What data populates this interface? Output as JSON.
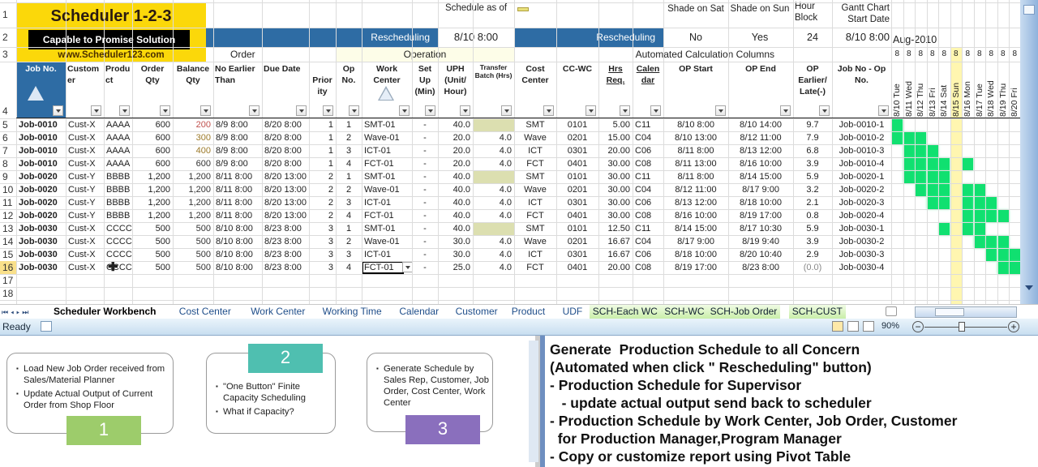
{
  "logo": {
    "title": "Scheduler 1-2-3",
    "tagline": "Capable to Promise  Solution",
    "url": "www.Scheduler123.com"
  },
  "top_controls": {
    "schedule_as_of_label": "Schedule as of",
    "schedule_as_of_value": "8/10 8:00",
    "rescheduling_left": "Rescheduling",
    "rescheduling_right": "Rescheduling",
    "shade_sat_label": "Shade on Sat",
    "shade_sat_value": "No",
    "shade_sun_label": "Shade on Sun",
    "shade_sun_value": "Yes",
    "hour_block_label": "Hour Block",
    "hour_block_value": "24",
    "gantt_start_label": "Gantt Chart Start Date",
    "gantt_start_value": "8/10 8:00",
    "gantt_month": "Aug-2010"
  },
  "section_headers": {
    "order": "Order",
    "operation": "Operation",
    "automated": "Automated Calculation Columns"
  },
  "columns": [
    "Job No.",
    "Custom er",
    "Produ ct",
    "Order Qty",
    "Balance Qty",
    "No Earlier Than",
    "Due Date",
    "Prior ity",
    "Op No.",
    "Work Center",
    "Set Up (Min)",
    "UPH (Unit/ Hour)",
    "Transfer Batch (Hrs)",
    "Cost Center",
    "CC-WC",
    "Hrs Req.",
    "Calen dar",
    "OP Start",
    "OP End",
    "OP Earlier/ Late(-)",
    "Job No - Op No."
  ],
  "row_numbers": [
    "1",
    "2",
    "3",
    "4",
    "5",
    "6",
    "7",
    "8",
    "9",
    "10",
    "11",
    "12",
    "13",
    "14",
    "15",
    "16",
    "17",
    "18"
  ],
  "gantt_days": [
    "8/10 Tue",
    "8/11 Wed",
    "8/12 Thu",
    "8/13 Fri",
    "8/14 Sat",
    "8/15 Sun",
    "8/16 Mon",
    "8/17 Tue",
    "8/18 Wed",
    "8/19 Thu",
    "8/20 Fri"
  ],
  "gantt_hours": [
    "8",
    "8",
    "8",
    "8",
    "8",
    "8",
    "8",
    "8",
    "8",
    "8",
    "8"
  ],
  "gantt_sunday_index": 5,
  "rows": [
    {
      "job": "Job-0010",
      "cust": "Cust-X",
      "prod": "AAAA",
      "oqty": "600",
      "bqty": "200",
      "bqty_color": "#c0504d",
      "net": "8/9 8:00",
      "due": "8/20 8:00",
      "pri": "1",
      "op": "1",
      "wc": "SMT-01",
      "setup": "-",
      "uph": "40.0",
      "tb": "",
      "cc": "SMT",
      "ccwc": "0101",
      "hrs": "5.00",
      "cal": "C11",
      "start": "8/10 8:00",
      "end": "8/10 14:00",
      "late": "9.7",
      "jobop": "Job-0010-1",
      "gantt": [
        0
      ]
    },
    {
      "job": "Job-0010",
      "cust": "Cust-X",
      "prod": "AAAA",
      "oqty": "600",
      "bqty": "300",
      "bqty_color": "#9c7a2a",
      "net": "8/9 8:00",
      "due": "8/20 8:00",
      "pri": "1",
      "op": "2",
      "wc": "Wave-01",
      "setup": "-",
      "uph": "20.0",
      "tb": "4.0",
      "cc": "Wave",
      "ccwc": "0201",
      "hrs": "15.00",
      "cal": "C04",
      "start": "8/10 13:00",
      "end": "8/12 11:00",
      "late": "7.9",
      "jobop": "Job-0010-2",
      "gantt": [
        0,
        1,
        2
      ]
    },
    {
      "job": "Job-0010",
      "cust": "Cust-X",
      "prod": "AAAA",
      "oqty": "600",
      "bqty": "400",
      "bqty_color": "#9c7a2a",
      "net": "8/9 8:00",
      "due": "8/20 8:00",
      "pri": "1",
      "op": "3",
      "wc": "ICT-01",
      "setup": "-",
      "uph": "20.0",
      "tb": "4.0",
      "cc": "ICT",
      "ccwc": "0301",
      "hrs": "20.00",
      "cal": "C06",
      "start": "8/11 8:00",
      "end": "8/13 12:00",
      "late": "6.8",
      "jobop": "Job-0010-3",
      "gantt": [
        1,
        2,
        3
      ]
    },
    {
      "job": "Job-0010",
      "cust": "Cust-X",
      "prod": "AAAA",
      "oqty": "600",
      "bqty": "600",
      "bqty_color": "#333333",
      "net": "8/9 8:00",
      "due": "8/20 8:00",
      "pri": "1",
      "op": "4",
      "wc": "FCT-01",
      "setup": "-",
      "uph": "20.0",
      "tb": "4.0",
      "cc": "FCT",
      "ccwc": "0401",
      "hrs": "30.00",
      "cal": "C08",
      "start": "8/11 13:00",
      "end": "8/16 10:00",
      "late": "3.9",
      "jobop": "Job-0010-4",
      "gantt": [
        1,
        2,
        3,
        4,
        6
      ]
    },
    {
      "job": "Job-0020",
      "cust": "Cust-Y",
      "prod": "BBBB",
      "oqty": "1,200",
      "bqty": "1,200",
      "bqty_color": "#333333",
      "net": "8/11 8:00",
      "due": "8/20 13:00",
      "pri": "2",
      "op": "1",
      "wc": "SMT-01",
      "setup": "-",
      "uph": "40.0",
      "tb": "",
      "cc": "SMT",
      "ccwc": "0101",
      "hrs": "30.00",
      "cal": "C11",
      "start": "8/11 8:00",
      "end": "8/14 15:00",
      "late": "5.9",
      "jobop": "Job-0020-1",
      "gantt": [
        1,
        2,
        3,
        4
      ]
    },
    {
      "job": "Job-0020",
      "cust": "Cust-Y",
      "prod": "BBBB",
      "oqty": "1,200",
      "bqty": "1,200",
      "bqty_color": "#333333",
      "net": "8/11 8:00",
      "due": "8/20 13:00",
      "pri": "2",
      "op": "2",
      "wc": "Wave-01",
      "setup": "-",
      "uph": "40.0",
      "tb": "4.0",
      "cc": "Wave",
      "ccwc": "0201",
      "hrs": "30.00",
      "cal": "C04",
      "start": "8/12 11:00",
      "end": "8/17 9:00",
      "late": "3.2",
      "jobop": "Job-0020-2",
      "gantt": [
        2,
        3,
        4,
        6,
        7
      ]
    },
    {
      "job": "Job-0020",
      "cust": "Cust-Y",
      "prod": "BBBB",
      "oqty": "1,200",
      "bqty": "1,200",
      "bqty_color": "#333333",
      "net": "8/11 8:00",
      "due": "8/20 13:00",
      "pri": "2",
      "op": "3",
      "wc": "ICT-01",
      "setup": "-",
      "uph": "40.0",
      "tb": "4.0",
      "cc": "ICT",
      "ccwc": "0301",
      "hrs": "30.00",
      "cal": "C06",
      "start": "8/13 12:00",
      "end": "8/18 10:00",
      "late": "2.1",
      "jobop": "Job-0020-3",
      "gantt": [
        3,
        4,
        6,
        7,
        8
      ]
    },
    {
      "job": "Job-0020",
      "cust": "Cust-Y",
      "prod": "BBBB",
      "oqty": "1,200",
      "bqty": "1,200",
      "bqty_color": "#333333",
      "net": "8/11 8:00",
      "due": "8/20 13:00",
      "pri": "2",
      "op": "4",
      "wc": "FCT-01",
      "setup": "-",
      "uph": "40.0",
      "tb": "4.0",
      "cc": "FCT",
      "ccwc": "0401",
      "hrs": "30.00",
      "cal": "C08",
      "start": "8/16 10:00",
      "end": "8/19 17:00",
      "late": "0.8",
      "jobop": "Job-0020-4",
      "gantt": [
        6,
        7,
        8,
        9
      ]
    },
    {
      "job": "Job-0030",
      "cust": "Cust-X",
      "prod": "CCCC",
      "oqty": "500",
      "bqty": "500",
      "bqty_color": "#333333",
      "net": "8/10 8:00",
      "due": "8/23 8:00",
      "pri": "3",
      "op": "1",
      "wc": "SMT-01",
      "setup": "-",
      "uph": "40.0",
      "tb": "",
      "cc": "SMT",
      "ccwc": "0101",
      "hrs": "12.50",
      "cal": "C11",
      "start": "8/14 15:00",
      "end": "8/17 10:30",
      "late": "5.9",
      "jobop": "Job-0030-1",
      "gantt": [
        4,
        6,
        7
      ]
    },
    {
      "job": "Job-0030",
      "cust": "Cust-X",
      "prod": "CCCC",
      "oqty": "500",
      "bqty": "500",
      "bqty_color": "#333333",
      "net": "8/10 8:00",
      "due": "8/23 8:00",
      "pri": "3",
      "op": "2",
      "wc": "Wave-01",
      "setup": "-",
      "uph": "30.0",
      "tb": "4.0",
      "cc": "Wave",
      "ccwc": "0201",
      "hrs": "16.67",
      "cal": "C04",
      "start": "8/17 9:00",
      "end": "8/19 9:40",
      "late": "3.9",
      "jobop": "Job-0030-2",
      "gantt": [
        7,
        8,
        9
      ]
    },
    {
      "job": "Job-0030",
      "cust": "Cust-X",
      "prod": "CCCC",
      "oqty": "500",
      "bqty": "500",
      "bqty_color": "#333333",
      "net": "8/10 8:00",
      "due": "8/23 8:00",
      "pri": "3",
      "op": "3",
      "wc": "ICT-01",
      "setup": "-",
      "uph": "30.0",
      "tb": "4.0",
      "cc": "ICT",
      "ccwc": "0301",
      "hrs": "16.67",
      "cal": "C06",
      "start": "8/18 10:00",
      "end": "8/20 10:40",
      "late": "2.9",
      "jobop": "Job-0030-3",
      "gantt": [
        8,
        9,
        10
      ]
    },
    {
      "job": "Job-0030",
      "cust": "Cust-X",
      "prod": "CCCC",
      "oqty": "500",
      "bqty": "500",
      "bqty_color": "#333333",
      "net": "8/10 8:00",
      "due": "8/23 8:00",
      "pri": "3",
      "op": "4",
      "wc": "FCT-01",
      "setup": "-",
      "uph": "25.0",
      "tb": "4.0",
      "cc": "FCT",
      "ccwc": "0401",
      "hrs": "20.00",
      "cal": "C08",
      "start": "8/19 17:00",
      "end": "8/23 8:00",
      "late": "(0.0)",
      "jobop": "Job-0030-4",
      "gantt": [
        9,
        10
      ]
    }
  ],
  "selected_row_index": 11,
  "sheet_tabs": [
    {
      "label": "Scheduler Workbench",
      "active": true,
      "green": false
    },
    {
      "label": "Cost Center",
      "active": false,
      "green": false
    },
    {
      "label": "Work Center",
      "active": false,
      "green": false
    },
    {
      "label": "Working Time",
      "active": false,
      "green": false
    },
    {
      "label": "Calendar",
      "active": false,
      "green": false
    },
    {
      "label": "Customer",
      "active": false,
      "green": false
    },
    {
      "label": "Product",
      "active": false,
      "green": false
    },
    {
      "label": "UDF",
      "active": false,
      "green": false
    },
    {
      "label": "SCH-Each WC",
      "active": false,
      "green": true
    },
    {
      "label": "SCH-WC",
      "active": false,
      "green": true
    },
    {
      "label": "SCH-Job Order",
      "active": false,
      "green": true
    },
    {
      "label": "SCH-CUST",
      "active": false,
      "green": true
    }
  ],
  "status_bar": {
    "status": "Ready",
    "zoom": "90%",
    "zoom_fraction": 0.45
  },
  "steps": [
    {
      "number": "1",
      "color": "#9dcc6b",
      "bullets": [
        "Load New Job Order received from Sales/Material Planner",
        "Update Actual Output of Current Order from Shop Floor"
      ]
    },
    {
      "number": "2",
      "color": "#4fbfb0",
      "bullets": [
        "\"One Button\" Finite Capacity Scheduling",
        "What if Capacity?"
      ]
    },
    {
      "number": "3",
      "color": "#8a6fbd",
      "bullets": [
        "Generate Schedule by Sales Rep, Customer, Job Order, Cost  Center, Work Center"
      ]
    }
  ],
  "description_lines": [
    "Generate  Production Schedule to all Concern",
    "(Automated when click \" Rescheduling\" button)",
    "- Production Schedule for Supervisor",
    "   - update actual output send back to scheduler",
    "- Production Schedule by Work Center, Job Order, Customer",
    "  for Production Manager,Program Manager",
    "- Copy or customize report using Pivot Table"
  ]
}
